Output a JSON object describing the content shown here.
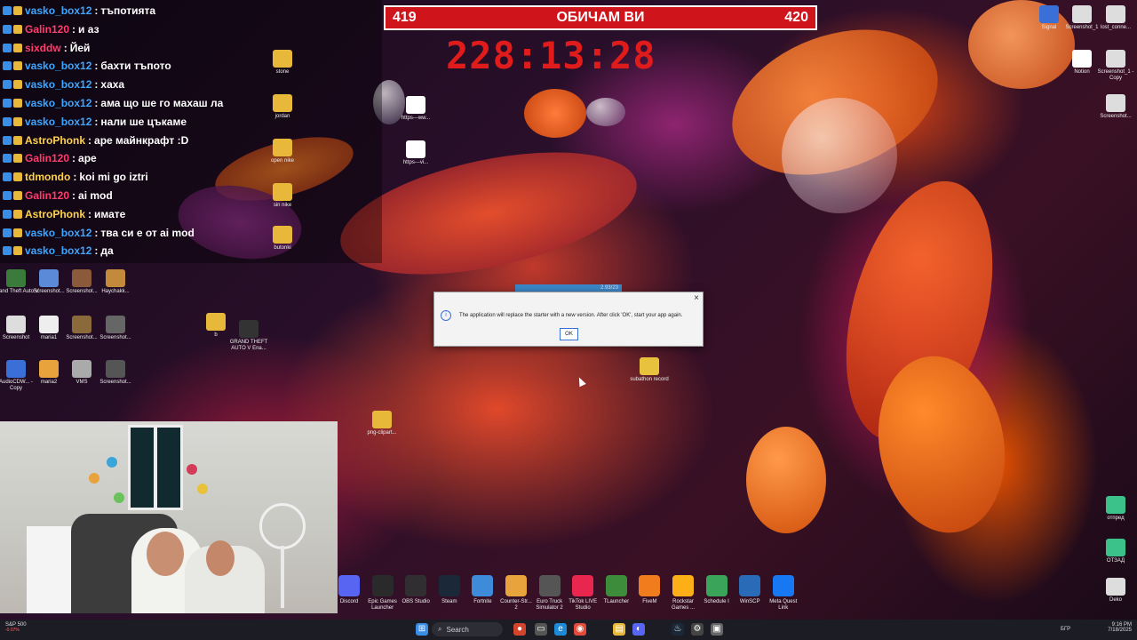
{
  "chat": {
    "lines": [
      {
        "user": "vasko_box12",
        "sep": ":",
        "text": "тъпотията",
        "color": "#3ea6ff"
      },
      {
        "user": "Galin120",
        "sep": ":",
        "text": "и аз",
        "color": "#ff3c6e"
      },
      {
        "user": "sixddw",
        "sep": ":",
        "text": "Йей",
        "color": "#ff3c6e"
      },
      {
        "user": "vasko_box12",
        "sep": ":",
        "text": "бахти тъпото",
        "color": "#3ea6ff"
      },
      {
        "user": "vasko_box12",
        "sep": ":",
        "text": "хаха",
        "color": "#3ea6ff"
      },
      {
        "user": "vasko_box12",
        "sep": ":",
        "text": "ама що ше го махаш ла",
        "color": "#3ea6ff"
      },
      {
        "user": "vasko_box12",
        "sep": ":",
        "text": "нали ше цъкаме",
        "color": "#3ea6ff"
      },
      {
        "user": "AstroPhonk",
        "sep": ":",
        "text": "аре майнкрафт :D",
        "color": "#ffd24a"
      },
      {
        "user": "Galin120",
        "sep": ":",
        "text": "аре",
        "color": "#ff3c6e"
      },
      {
        "user": "tdmondo",
        "sep": ":",
        "text": "koi mi go iztri",
        "color": "#ffd24a"
      },
      {
        "user": "Galin120",
        "sep": ":",
        "text": "ai mod",
        "color": "#ff3c6e"
      },
      {
        "user": "AstroPhonk",
        "sep": ":",
        "text": "имате",
        "color": "#ffd24a"
      },
      {
        "user": "vasko_box12",
        "sep": ":",
        "text": "тва си е от ai mod",
        "color": "#3ea6ff"
      },
      {
        "user": "vasko_box12",
        "sep": ":",
        "text": "да",
        "color": "#3ea6ff"
      }
    ]
  },
  "counter": {
    "left": "419",
    "title": "ОБИЧАМ ВИ",
    "right": "420"
  },
  "timer": "228:13:28",
  "dialog": {
    "message": "The application will replace the starter with a new version. After click 'OK', start your app again.",
    "ok": "OK",
    "progress": "2.93/23",
    "close": "×"
  },
  "desktop_icons": {
    "left_col": [
      "Grand Theft Auto V",
      "Screenshot...",
      "Screenshot...",
      "Haychakk...",
      "Screenshot",
      "maria1",
      "Screenshot...",
      "Screenshot...",
      "AudioCDW... - Copy",
      "maria2",
      "VMS",
      "Screenshot..."
    ],
    "mid": [
      "stone",
      "jordan",
      "open nike",
      "sin nike",
      "butonki",
      "https---ww...",
      "https---vi...",
      "b",
      "GRAND THEFT AUTO V Ena...",
      "png-clipart...",
      "subathon record"
    ],
    "right": [
      "Signal",
      "Screenshot_1",
      "lost_conne...",
      "Notion",
      "Screenshot_1 - Copy",
      "Screenshot...",
      "отпред",
      "ОТЗАД",
      "Deko"
    ]
  },
  "dock": [
    {
      "label": "Discord",
      "icon": "discord-icon",
      "color": "#5865f2"
    },
    {
      "label": "Epic Games Launcher",
      "icon": "epic-icon",
      "color": "#2a2a2a"
    },
    {
      "label": "OBS Studio",
      "icon": "obs-icon",
      "color": "#302e31"
    },
    {
      "label": "Steam",
      "icon": "steam-icon",
      "color": "#1b2838"
    },
    {
      "label": "Fortnite",
      "icon": "fortnite-icon",
      "color": "#3d8bd9"
    },
    {
      "label": "Counter-Str... 2",
      "icon": "cs2-icon",
      "color": "#e8a33c"
    },
    {
      "label": "Euro Truck Simulator 2",
      "icon": "ets2-icon",
      "color": "#555"
    },
    {
      "label": "TikTok LIVE Studio",
      "icon": "tiktok-icon",
      "color": "#e8264e"
    },
    {
      "label": "TLauncher",
      "icon": "tlauncher-icon",
      "color": "#3c8c3c"
    },
    {
      "label": "FiveM",
      "icon": "fivem-icon",
      "color": "#f07c1e"
    },
    {
      "label": "Rockstar Games ...",
      "icon": "rockstar-icon",
      "color": "#fcaf17"
    },
    {
      "label": "Schedule I",
      "icon": "schedule-icon",
      "color": "#3aa55a"
    },
    {
      "label": "WinSCP",
      "icon": "winscp-icon",
      "color": "#2a6bb8"
    },
    {
      "label": "Meta Quest Link",
      "icon": "meta-icon",
      "color": "#1877f2"
    }
  ],
  "taskbar": {
    "stock_name": "S&P 500",
    "stock_change": "-0.07%",
    "search": "Search",
    "lang": "БГР",
    "time": "9:16 PM",
    "date": "7/18/2025"
  }
}
